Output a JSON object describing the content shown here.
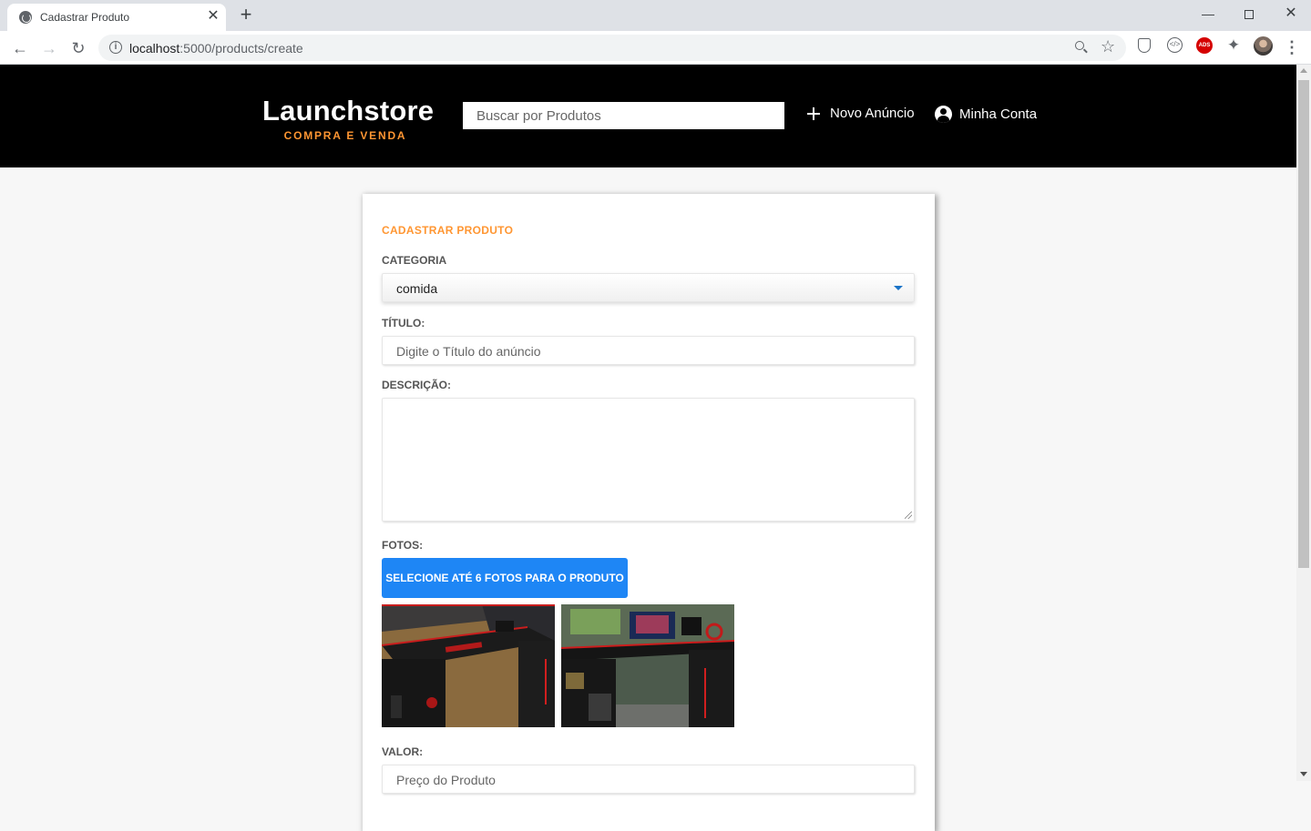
{
  "browser": {
    "tab_title": "Cadastrar Produto",
    "tab_close": "✕",
    "new_tab": "+",
    "url_host": "localhost",
    "url_rest": ":5000/products/create",
    "window_min": "—",
    "window_close": "✕",
    "ext_ads_label": "ADS"
  },
  "header": {
    "logo_title": "Launchstore",
    "logo_subtitle": "COMPRA E VENDA",
    "search_placeholder": "Buscar por Produtos",
    "new_ad_label": "Novo Anúncio",
    "account_label": "Minha Conta"
  },
  "form": {
    "title": "CADASTRAR PRODUTO",
    "category_label": "CATEGORIA",
    "category_value": "comida",
    "title_label": "TÍTULO:",
    "title_placeholder": "Digite o Título do anúncio",
    "description_label": "DESCRIÇÃO:",
    "photos_label": "FOTOS:",
    "photos_button": "SELECIONE ATÉ 6 FOTOS PARA O PRODUTO",
    "value_label": "VALOR:",
    "value_placeholder": "Preço do Produto"
  },
  "colors": {
    "accent_orange": "#ff9632",
    "button_blue": "#1e86f5",
    "header_bg": "#000000"
  },
  "icons": [
    "globe-icon",
    "back-arrow-icon",
    "forward-arrow-icon",
    "reload-icon",
    "info-icon",
    "zoom-icon",
    "star-icon",
    "shield-icon",
    "code-icon",
    "ads-icon",
    "puzzle-icon",
    "avatar",
    "menu-icon",
    "plus-icon",
    "account-icon",
    "chevron-down-icon"
  ]
}
